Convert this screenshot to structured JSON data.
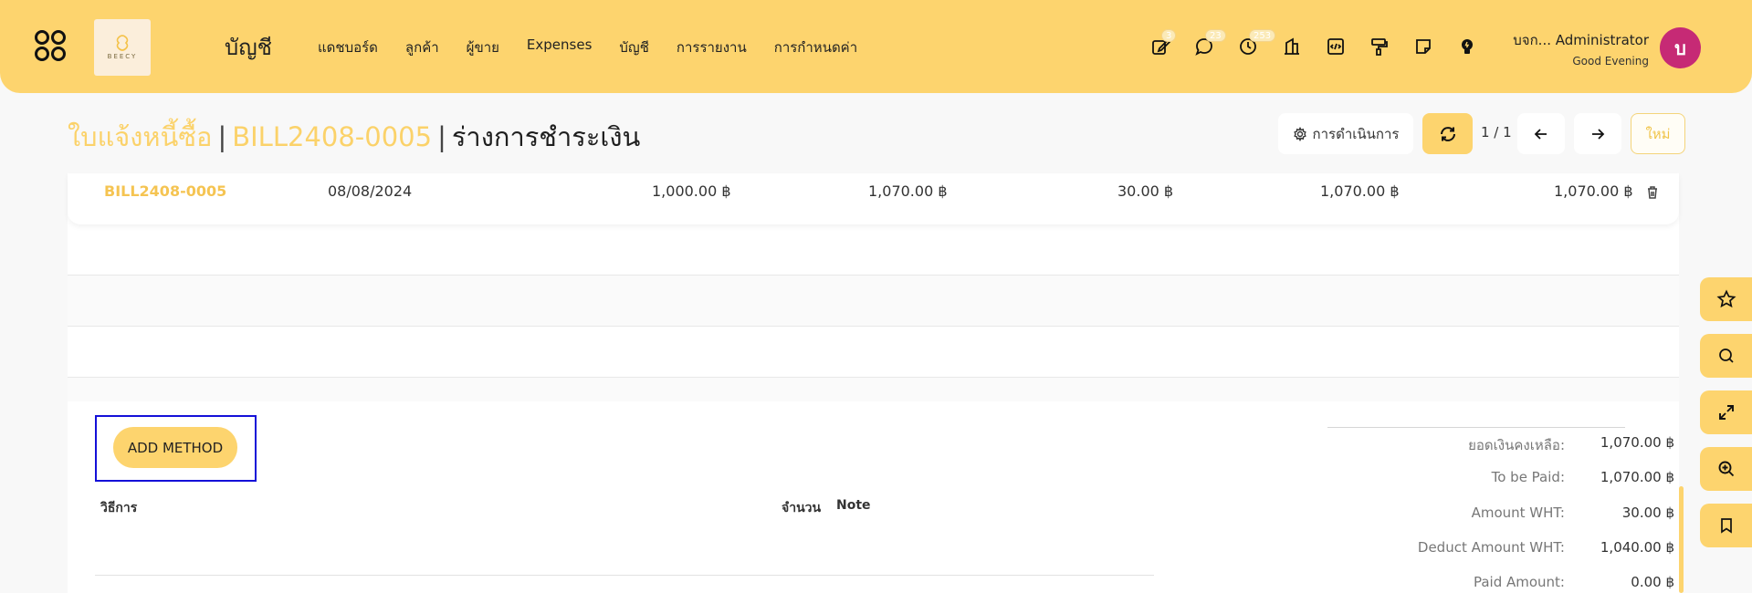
{
  "navbar": {
    "logo_text": "BEECY",
    "module_title": "บัญชี",
    "menu": [
      "แดชบอร์ด",
      "ลูกค้า",
      "ผู้ขาย",
      "Expenses",
      "บัญชี",
      "การรายงาน",
      "การกำหนดค่า"
    ],
    "icons": [
      {
        "name": "edit-note-icon",
        "badge": "3"
      },
      {
        "name": "chat-icon",
        "badge": "23"
      },
      {
        "name": "activity-clock-icon",
        "badge": "253"
      },
      {
        "name": "bank-icon",
        "badge": ""
      },
      {
        "name": "code-icon",
        "badge": ""
      },
      {
        "name": "paint-roller-icon",
        "badge": ""
      },
      {
        "name": "sticky-note-icon",
        "badge": ""
      },
      {
        "name": "lightbulb-icon",
        "badge": ""
      }
    ],
    "user_name": "บจก... Administrator",
    "greeting": "Good Evening",
    "avatar_letter": "บ",
    "accent_color": "#fdd46e",
    "avatar_color": "#c62a75"
  },
  "breadcrumb": {
    "parent": "ใบแจ้งหนี้ซื้อ",
    "record": "BILL2408-0005",
    "current": "ร่างการชำระเงิน",
    "separator": "|"
  },
  "toolbar": {
    "actions_label": "การดำเนินการ",
    "pager": "1 / 1",
    "new_label": "ใหม่"
  },
  "bill_row": {
    "number": "BILL2408-0005",
    "date": "08/08/2024",
    "amount1": "1,000.00 ฿",
    "amount2": "1,070.00 ฿",
    "wht": "30.00 ฿",
    "amount3": "1,070.00 ฿",
    "amount4": "1,070.00 ฿"
  },
  "payment": {
    "add_method_label": "ADD METHOD",
    "col_method": "วิธีการ",
    "col_amount": "จำนวน",
    "col_note": "Note"
  },
  "summary": [
    {
      "label": "ยอดเงินคงเหลือ:",
      "value": "1,070.00 ฿"
    },
    {
      "label": "To be Paid:",
      "value": "1,070.00 ฿"
    },
    {
      "label": "Amount WHT:",
      "value": "30.00 ฿"
    },
    {
      "label": "Deduct Amount WHT:",
      "value": "1,040.00 ฿"
    },
    {
      "label": "Paid Amount:",
      "value": "0.00 ฿"
    }
  ],
  "dock": [
    "star-icon",
    "search-icon",
    "expand-icon",
    "zoom-in-icon",
    "bookmark-icon"
  ]
}
